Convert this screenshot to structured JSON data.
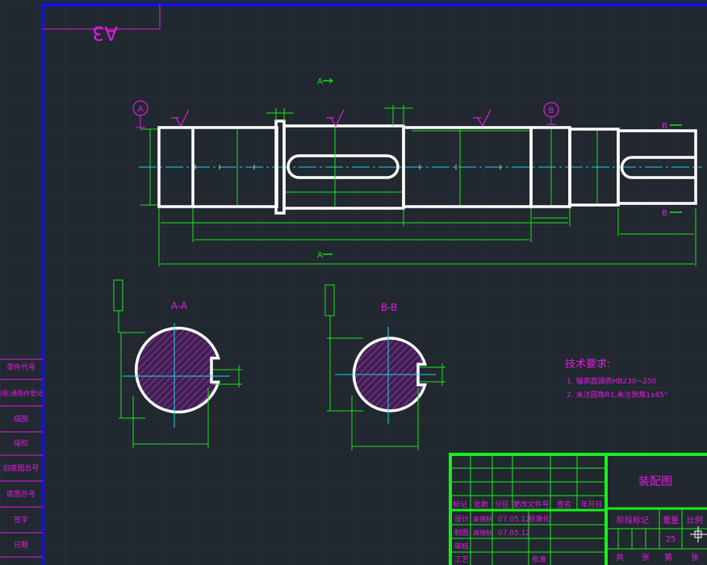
{
  "drawing_number": "A3",
  "section_labels": {
    "a_top": "A",
    "a_bottom": "A",
    "b_top": "B",
    "b_bottom": "B",
    "datum_a": "A",
    "datum_b": "B",
    "section_aa": "A-A",
    "section_bb": "B-B"
  },
  "technical_requirements": {
    "title": "技术要求:",
    "items": [
      "1. 轴表面调质HB230~250",
      "2. 未注圆角R1,未注倒角1x45°"
    ]
  },
  "left_strip": {
    "items": [
      "零件代号",
      "(借)通用件登记",
      "描图",
      "描校",
      "旧底图总号",
      "底图总号",
      "签字",
      "日期"
    ]
  },
  "title_block": {
    "drawing_name": "装配图",
    "rev_headers": [
      "标记",
      "处数",
      "分区",
      "更改文件号",
      "签名",
      "年月日"
    ],
    "rows": [
      {
        "role": "设计",
        "name": "高锦秋",
        "date": "07.05.12",
        "std": "标准化"
      },
      {
        "role": "制图",
        "name": "高锦秋",
        "date": "07.05.12",
        "std": ""
      },
      {
        "role": "审核",
        "name": "",
        "date": "",
        "std": ""
      },
      {
        "role": "工艺",
        "name": "",
        "date": "",
        "std": "批准"
      }
    ],
    "stage_label": "阶段标记",
    "weight_label": "重量",
    "scale_label": "比例",
    "scale_value": "25",
    "sheets_label": "共",
    "sheet_of": "张",
    "sheet_label": "第",
    "sheet_unit": "张"
  },
  "colors": {
    "background": "#212830",
    "grid": "#2c3440",
    "outline": "#ffffff",
    "dimension": "#19e619",
    "centerline": "#10d8e8",
    "magenta": "#e01ce0",
    "border": "#1010f0",
    "hatch": "#b0209a",
    "title_green": "#16f016"
  }
}
